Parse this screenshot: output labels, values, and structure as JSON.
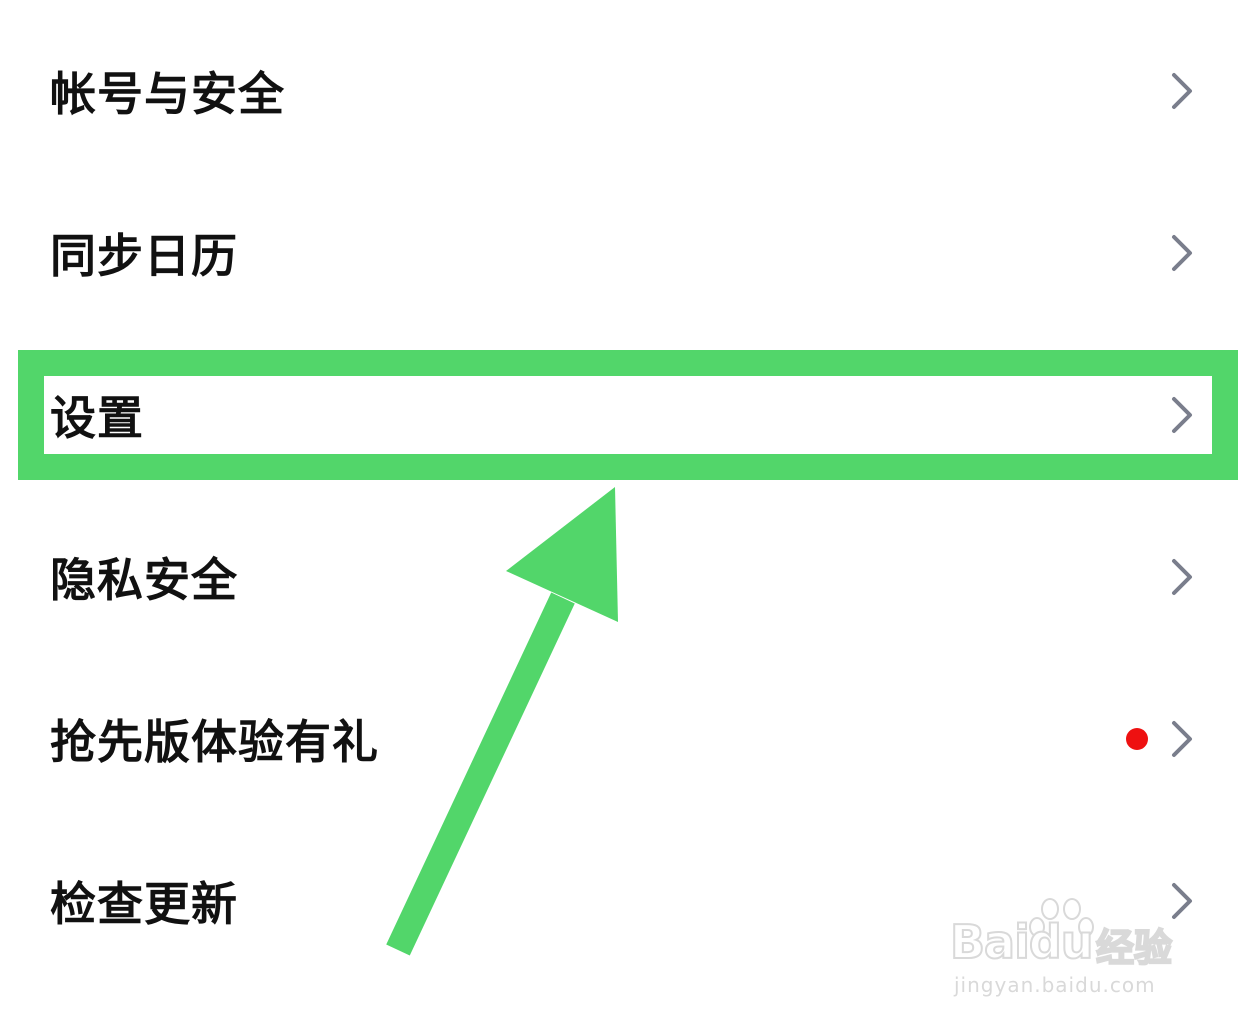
{
  "menu": {
    "items": [
      {
        "label": "帐号与安全",
        "badge": false
      },
      {
        "label": "同步日历",
        "badge": false
      },
      {
        "label": "设置",
        "badge": false
      },
      {
        "label": "隐私安全",
        "badge": false
      },
      {
        "label": "抢先版体验有礼",
        "badge": true
      },
      {
        "label": "检查更新",
        "badge": false
      }
    ],
    "chevron_icon": "chevron-right-icon",
    "badge_icon": "red-dot-icon"
  },
  "annotation": {
    "highlighted_item": "设置",
    "highlight_color": "#52d66a",
    "arrow_color": "#52d66a"
  },
  "colors": {
    "text": "#111111",
    "chevron": "#7a7e8c",
    "badge": "#ee1111",
    "background": "#ffffff"
  },
  "watermark": {
    "logo": "Baidu",
    "logo_cn": "经验",
    "url": "jingyan.baidu.com"
  }
}
